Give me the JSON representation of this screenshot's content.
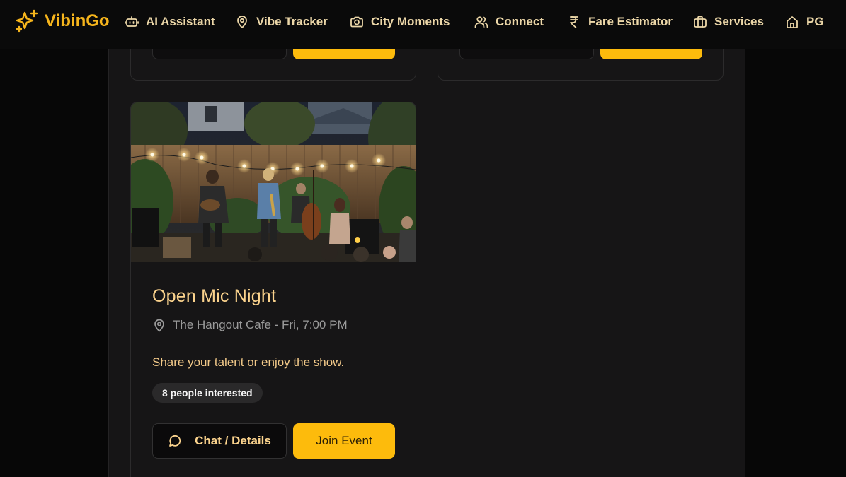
{
  "brand": {
    "name": "VibinGo",
    "icon": "sparkles-icon"
  },
  "nav": [
    {
      "label": "AI Assistant",
      "icon": "bot-icon"
    },
    {
      "label": "Vibe Tracker",
      "icon": "map-pin-icon"
    },
    {
      "label": "City Moments",
      "icon": "camera-icon"
    },
    {
      "label": "Connect",
      "icon": "users-icon"
    },
    {
      "label": "Fare Estimator",
      "icon": "rupee-icon"
    },
    {
      "label": "Services",
      "icon": "briefcase-icon"
    },
    {
      "label": "PG",
      "icon": "home-icon"
    }
  ],
  "event": {
    "title": "Open Mic Night",
    "location": "The Hangout Cafe - Fri, 7:00 PM",
    "description": "Share your talent or enjoy the show.",
    "interested": "8 people interested",
    "chat_label": "Chat / Details",
    "join_label": "Join Event",
    "image_alt": "Band performing outdoors under string lights"
  },
  "colors": {
    "accent": "#fdbb0c",
    "brand": "#f6b51c",
    "title": "#fbd38d",
    "background": "#070707",
    "panel": "#161516"
  }
}
